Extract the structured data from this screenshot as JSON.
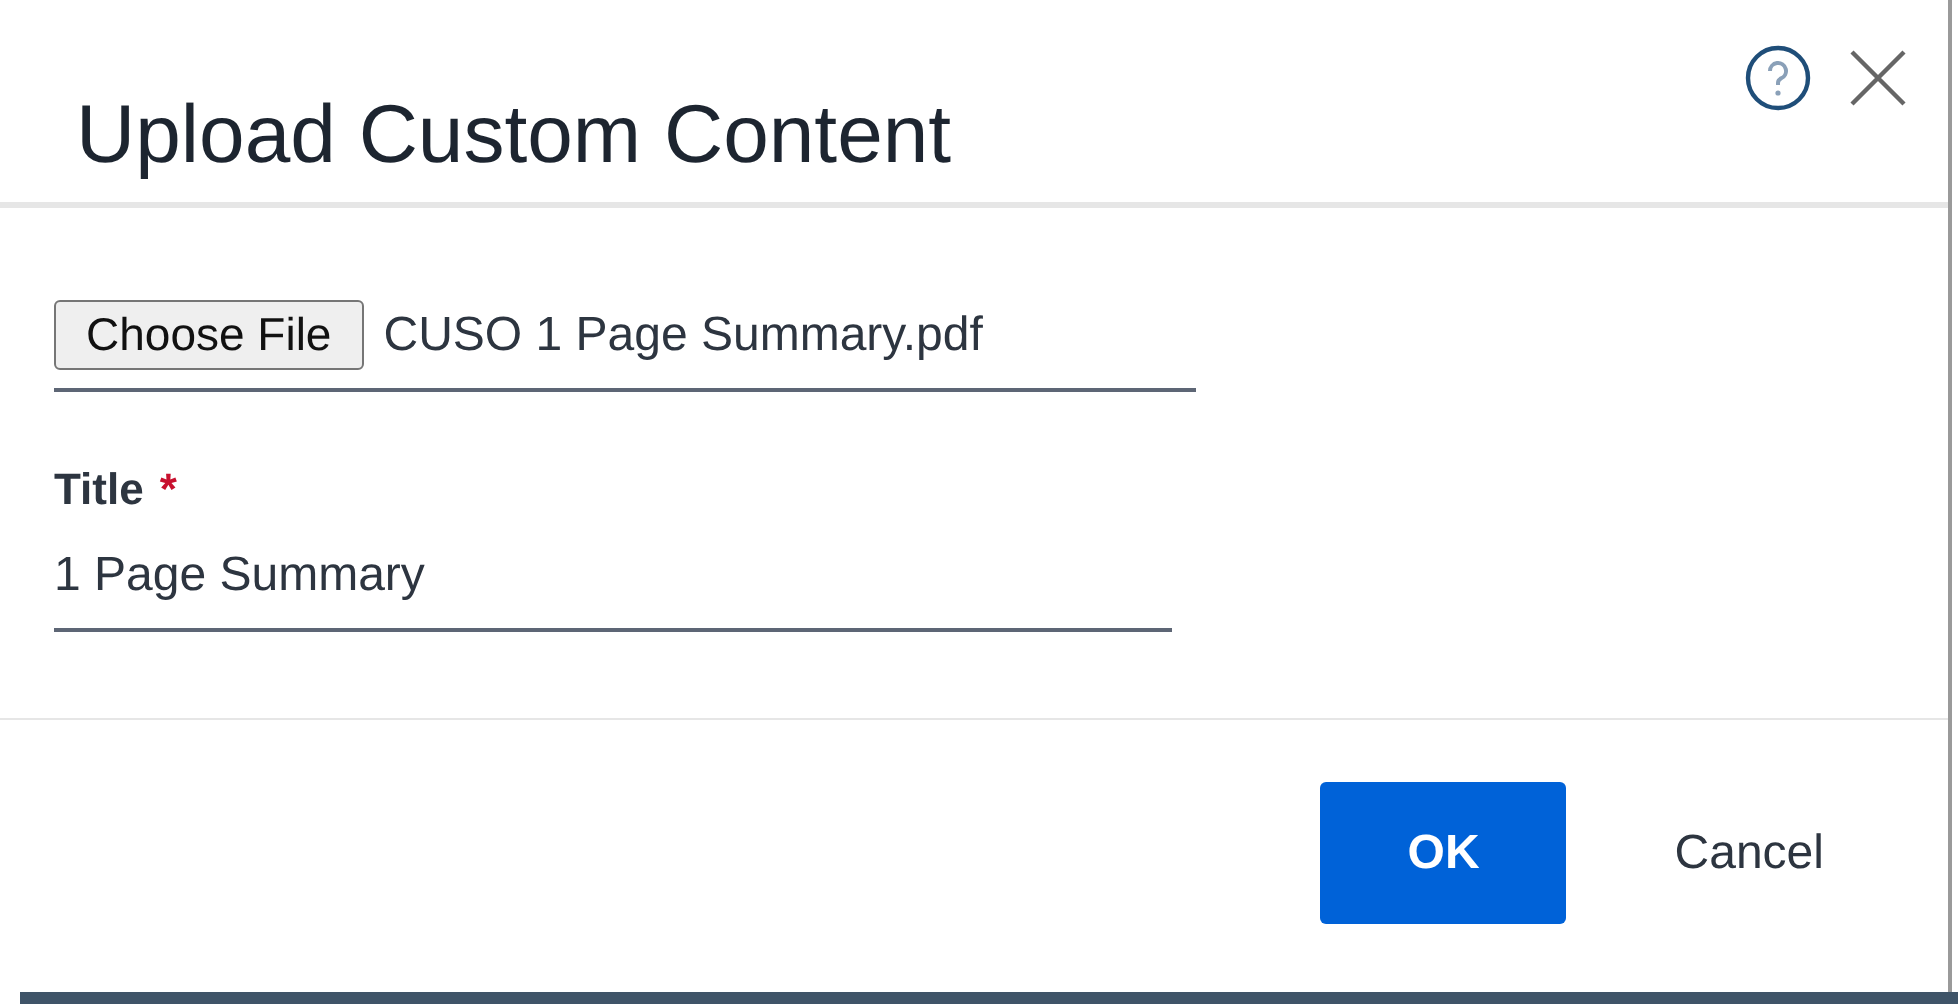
{
  "dialog": {
    "title": "Upload Custom Content",
    "file_input": {
      "button": "Choose File",
      "file_name": "CUSO 1 Page Summary.pdf"
    },
    "title_field": {
      "label": "Title",
      "required_mark": "*",
      "value": "1 Page Summary"
    },
    "buttons": [
      {
        "label": "OK",
        "kind": "primary"
      },
      {
        "label": "Cancel",
        "kind": "link"
      }
    ]
  }
}
